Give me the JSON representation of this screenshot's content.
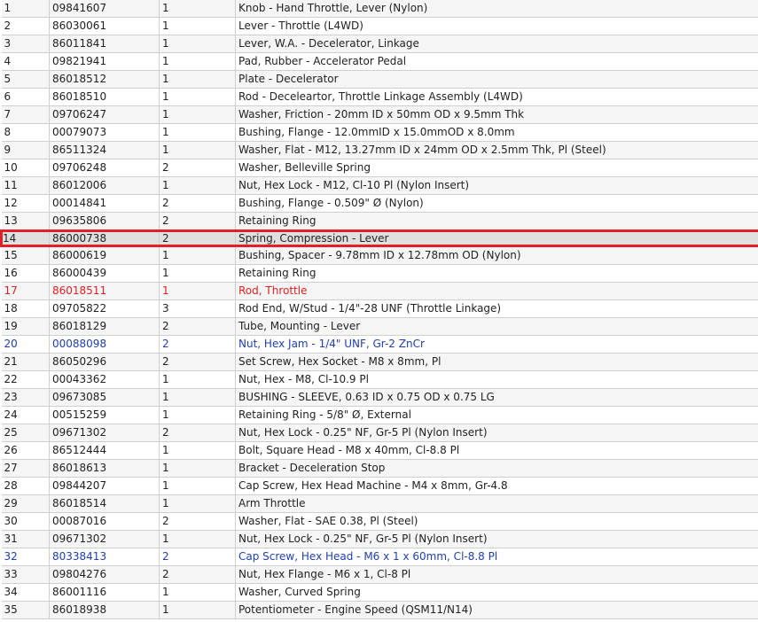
{
  "colors": {
    "highlight_border": "#e41e26",
    "red_text": "#e02020",
    "blue_text": "#2040b0",
    "selected_bg": "#e0e0e0"
  },
  "rows": [
    {
      "ref": "1",
      "part": "09841607",
      "qty": "1",
      "desc": "Knob - Hand Throttle, Lever (Nylon)"
    },
    {
      "ref": "2",
      "part": "86030061",
      "qty": "1",
      "desc": "Lever - Throttle (L4WD)"
    },
    {
      "ref": "3",
      "part": "86011841",
      "qty": "1",
      "desc": "Lever, W.A. - Decelerator, Linkage"
    },
    {
      "ref": "4",
      "part": "09821941",
      "qty": "1",
      "desc": "Pad, Rubber - Accelerator Pedal"
    },
    {
      "ref": "5",
      "part": "86018512",
      "qty": "1",
      "desc": "Plate - Decelerator"
    },
    {
      "ref": "6",
      "part": "86018510",
      "qty": "1",
      "desc": "Rod - Deceleartor, Throttle Linkage Assembly (L4WD)"
    },
    {
      "ref": "7",
      "part": "09706247",
      "qty": "1",
      "desc": "Washer, Friction - 20mm ID x 50mm OD x 9.5mm Thk"
    },
    {
      "ref": "8",
      "part": "00079073",
      "qty": "1",
      "desc": "Bushing, Flange - 12.0mmID x 15.0mmOD x 8.0mm"
    },
    {
      "ref": "9",
      "part": "86511324",
      "qty": "1",
      "desc": "Washer, Flat - M12, 13.27mm ID x 24mm OD x 2.5mm Thk, Pl (Steel)"
    },
    {
      "ref": "10",
      "part": "09706248",
      "qty": "2",
      "desc": "Washer, Belleville Spring"
    },
    {
      "ref": "11",
      "part": "86012006",
      "qty": "1",
      "desc": "Nut, Hex Lock - M12, Cl-10 Pl (Nylon Insert)"
    },
    {
      "ref": "12",
      "part": "00014841",
      "qty": "2",
      "desc": "Bushing, Flange - 0.509\" Ø (Nylon)"
    },
    {
      "ref": "13",
      "part": "09635806",
      "qty": "2",
      "desc": "Retaining Ring"
    },
    {
      "ref": "14",
      "part": "86000738",
      "qty": "2",
      "desc": "Spring, Compression - Lever"
    },
    {
      "ref": "15",
      "part": "86000619",
      "qty": "1",
      "desc": "Bushing, Spacer - 9.78mm ID x 12.78mm OD (Nylon)"
    },
    {
      "ref": "16",
      "part": "86000439",
      "qty": "1",
      "desc": "Retaining Ring"
    },
    {
      "ref": "17",
      "part": "86018511",
      "qty": "1",
      "desc": "Rod, Throttle"
    },
    {
      "ref": "18",
      "part": "09705822",
      "qty": "3",
      "desc": "Rod End, W/Stud - 1/4\"-28 UNF (Throttle Linkage)"
    },
    {
      "ref": "19",
      "part": "86018129",
      "qty": "2",
      "desc": "Tube, Mounting - Lever"
    },
    {
      "ref": "20",
      "part": "00088098",
      "qty": "2",
      "desc": "Nut, Hex Jam - 1/4\" UNF, Gr-2 ZnCr"
    },
    {
      "ref": "21",
      "part": "86050296",
      "qty": "2",
      "desc": "Set Screw, Hex Socket - M8 x 8mm, Pl"
    },
    {
      "ref": "22",
      "part": "00043362",
      "qty": "1",
      "desc": "Nut, Hex - M8, Cl-10.9 Pl"
    },
    {
      "ref": "23",
      "part": "09673085",
      "qty": "1",
      "desc": "BUSHING - SLEEVE, 0.63 ID x 0.75 OD x 0.75 LG"
    },
    {
      "ref": "24",
      "part": "00515259",
      "qty": "1",
      "desc": "Retaining Ring - 5/8\" Ø, External"
    },
    {
      "ref": "25",
      "part": "09671302",
      "qty": "2",
      "desc": "Nut, Hex Lock - 0.25\" NF, Gr-5 Pl (Nylon Insert)"
    },
    {
      "ref": "26",
      "part": "86512444",
      "qty": "1",
      "desc": "Bolt, Square Head - M8 x 40mm, Cl-8.8 Pl"
    },
    {
      "ref": "27",
      "part": "86018613",
      "qty": "1",
      "desc": "Bracket - Deceleration Stop"
    },
    {
      "ref": "28",
      "part": "09844207",
      "qty": "1",
      "desc": "Cap Screw, Hex Head Machine - M4 x 8mm, Gr-4.8"
    },
    {
      "ref": "29",
      "part": "86018514",
      "qty": "1",
      "desc": "Arm Throttle"
    },
    {
      "ref": "30",
      "part": "00087016",
      "qty": "2",
      "desc": "Washer, Flat - SAE 0.38, Pl (Steel)"
    },
    {
      "ref": "31",
      "part": "09671302",
      "qty": "1",
      "desc": "Nut, Hex Lock - 0.25\" NF, Gr-5 Pl (Nylon Insert)"
    },
    {
      "ref": "32",
      "part": "80338413",
      "qty": "2",
      "desc": "Cap Screw, Hex Head - M6 x 1 x 60mm, Cl-8.8 Pl"
    },
    {
      "ref": "33",
      "part": "09804276",
      "qty": "2",
      "desc": "Nut, Hex Flange - M6 x 1, Cl-8 Pl"
    },
    {
      "ref": "34",
      "part": "86001116",
      "qty": "1",
      "desc": "Washer, Curved Spring"
    },
    {
      "ref": "35",
      "part": "86018938",
      "qty": "1",
      "desc": "Potentiometer - Engine Speed (QSM11/N14)"
    }
  ]
}
